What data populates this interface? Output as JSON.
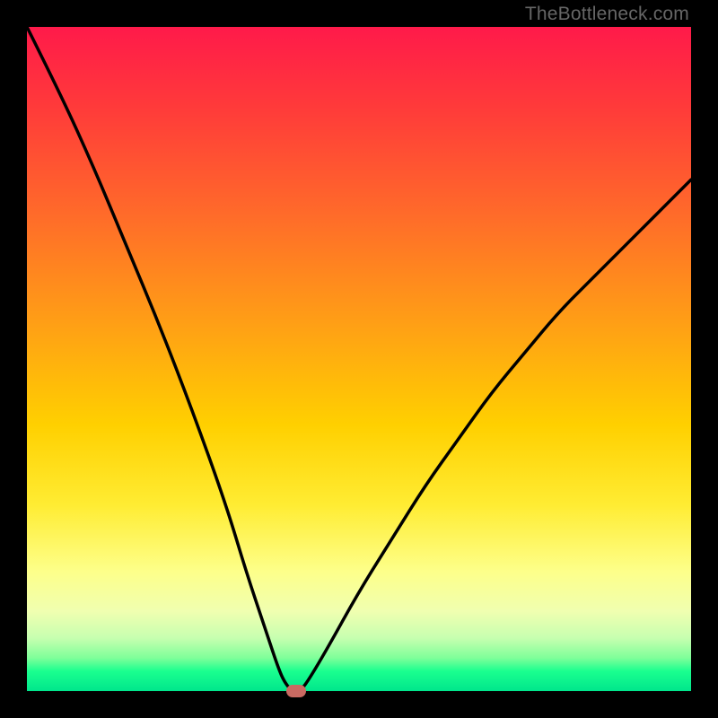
{
  "watermark": "TheBottleneck.com",
  "colors": {
    "background": "#000000",
    "curve_stroke": "#000000",
    "marker": "#c96a62"
  },
  "chart_data": {
    "type": "line",
    "title": "",
    "xlabel": "",
    "ylabel": "",
    "xlim": [
      0,
      100
    ],
    "ylim": [
      0,
      100
    ],
    "grid": false,
    "legend": false,
    "series": [
      {
        "name": "bottleneck-curve",
        "x": [
          0,
          5,
          10,
          15,
          20,
          25,
          30,
          33,
          36,
          38,
          39,
          40,
          41,
          42,
          45,
          50,
          55,
          60,
          65,
          70,
          75,
          80,
          85,
          90,
          95,
          100
        ],
        "y": [
          100,
          90,
          79,
          67,
          55,
          42,
          28,
          18,
          9,
          3,
          1,
          0,
          0,
          1,
          6,
          15,
          23,
          31,
          38,
          45,
          51,
          57,
          62,
          67,
          72,
          77
        ]
      }
    ],
    "marker": {
      "x": 40.5,
      "y": 0
    },
    "notes": "V-shaped bottleneck curve over a vertical rainbow gradient (red→green). No axes or tick labels are shown; values estimated from geometry."
  }
}
